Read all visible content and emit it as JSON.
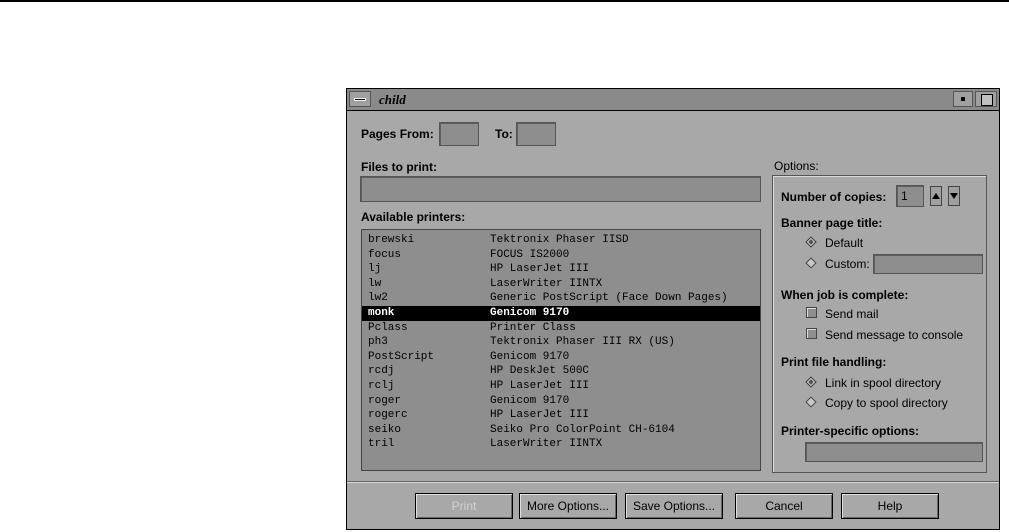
{
  "window": {
    "title": "child"
  },
  "pages": {
    "from_label": "Pages From:",
    "from_value": "",
    "to_label": "To:",
    "to_value": ""
  },
  "files": {
    "label": "Files to print:",
    "value": ""
  },
  "printers": {
    "label": "Available printers:",
    "rows": [
      {
        "name": "brewski",
        "desc": "Tektronix Phaser IISD",
        "selected": false
      },
      {
        "name": "focus",
        "desc": "FOCUS IS2000",
        "selected": false
      },
      {
        "name": "lj",
        "desc": "HP LaserJet III",
        "selected": false
      },
      {
        "name": "lw",
        "desc": "LaserWriter IINTX",
        "selected": false
      },
      {
        "name": "lw2",
        "desc": "Generic PostScript (Face Down Pages)",
        "selected": false
      },
      {
        "name": "monk",
        "desc": "Genicom 9170",
        "selected": true
      },
      {
        "name": "Pclass",
        "desc": "Printer Class",
        "selected": false
      },
      {
        "name": "ph3",
        "desc": "Tektronix Phaser III RX (US)",
        "selected": false
      },
      {
        "name": "PostScript",
        "desc": "Genicom 9170",
        "selected": false
      },
      {
        "name": "rcdj",
        "desc": "HP DeskJet 500C",
        "selected": false
      },
      {
        "name": "rclj",
        "desc": "HP LaserJet III",
        "selected": false
      },
      {
        "name": "roger",
        "desc": "Genicom 9170",
        "selected": false
      },
      {
        "name": "rogerc",
        "desc": "HP LaserJet III",
        "selected": false
      },
      {
        "name": "seiko",
        "desc": "Seiko Pro ColorPoint CH-6104",
        "selected": false
      },
      {
        "name": "tril",
        "desc": "LaserWriter IINTX",
        "selected": false
      }
    ]
  },
  "options": {
    "label": "Options:",
    "copies_label": "Number of copies:",
    "copies_value": "1",
    "banner_label": "Banner page title:",
    "banner_default": "Default",
    "banner_custom": "Custom:",
    "banner_custom_value": "",
    "complete_label": "When job is complete:",
    "send_mail": "Send mail",
    "send_console": "Send message to console",
    "handling_label": "Print file handling:",
    "link_spool": "Link in spool directory",
    "copy_spool": "Copy to spool directory",
    "specific_label": "Printer-specific options:",
    "specific_value": ""
  },
  "buttons": {
    "print": "Print",
    "more": "More Options...",
    "save": "Save Options...",
    "cancel": "Cancel",
    "help": "Help"
  },
  "colors": {
    "window_bg": "#a8a8a8",
    "field_bg": "#8e8e8e",
    "selection": "#000000"
  }
}
